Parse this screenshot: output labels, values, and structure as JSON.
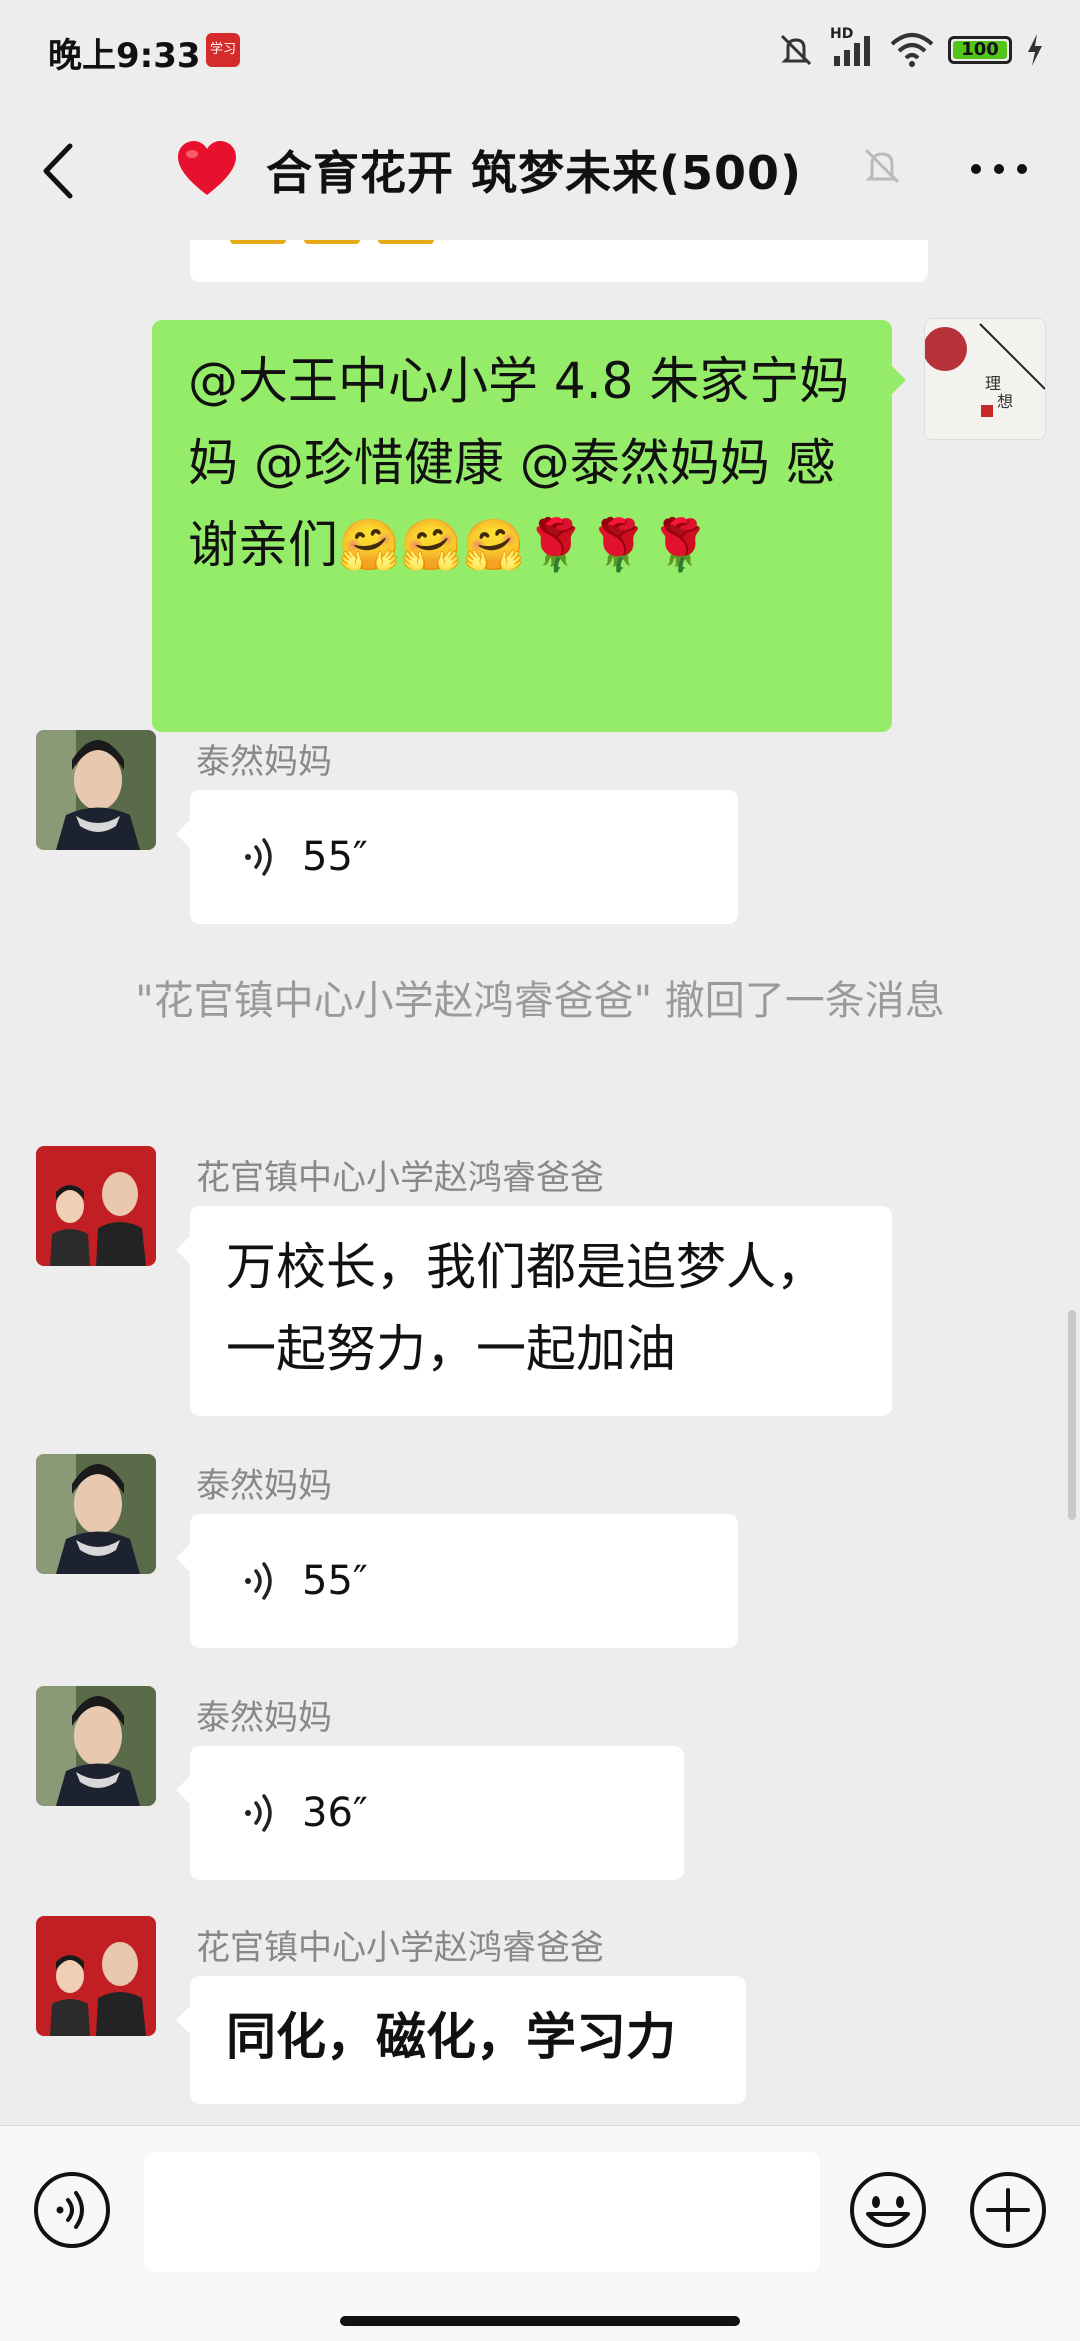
{
  "status_bar": {
    "time": "晚上9:33",
    "app_badge": "学习",
    "hd_label": "HD",
    "battery": "100"
  },
  "header": {
    "title": "合育花开 筑梦未来(500)",
    "title_icon": "heart-icon",
    "back_icon": "chevron-left-icon",
    "mute_icon": "bell-muted-icon",
    "more_icon": "more-dots-icon"
  },
  "messages": [
    {
      "type": "text-self",
      "text": "@大王中心小学 4.8 朱家宁妈妈 @珍惜健康 @泰然妈妈 感谢亲们🤗🤗🤗🌹🌹🌹"
    },
    {
      "type": "voice",
      "sender": "泰然妈妈",
      "duration": "55″"
    },
    {
      "type": "system",
      "text": "\"花官镇中心小学赵鸿睿爸爸\" 撤回了一条消息"
    },
    {
      "type": "text",
      "sender": "花官镇中心小学赵鸿睿爸爸",
      "text": "万校长，我们都是追梦人，一起努力，一起加油"
    },
    {
      "type": "voice",
      "sender": "泰然妈妈",
      "duration": "55″"
    },
    {
      "type": "voice",
      "sender": "泰然妈妈",
      "duration": "36″"
    },
    {
      "type": "text",
      "sender": "花官镇中心小学赵鸿睿爸爸",
      "text": "同化，磁化，学习力"
    }
  ],
  "input": {
    "voice_icon": "voice-toggle-icon",
    "emoji_icon": "emoji-icon",
    "plus_icon": "plus-icon",
    "value": ""
  },
  "colors": {
    "self_bubble": "#95ec69",
    "other_bubble": "#ffffff",
    "background": "#ededed"
  }
}
